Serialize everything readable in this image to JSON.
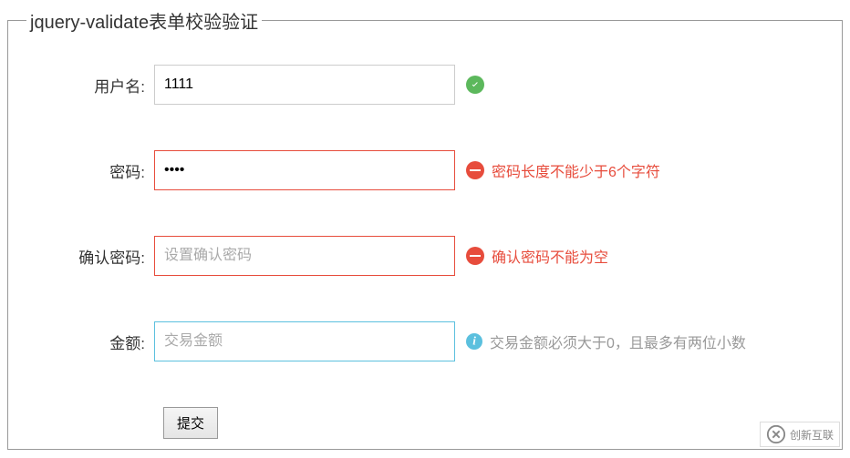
{
  "legend": "jquery-validate表单校验验证",
  "fields": {
    "username": {
      "label": "用户名:",
      "value": "1111",
      "status": "valid"
    },
    "password": {
      "label": "密码:",
      "value": "••••",
      "status": "error",
      "message": "密码长度不能少于6个字符"
    },
    "confirm": {
      "label": "确认密码:",
      "value": "",
      "placeholder": "设置确认密码",
      "status": "error",
      "message": "确认密码不能为空"
    },
    "amount": {
      "label": "金额:",
      "value": "",
      "placeholder": "交易金额",
      "status": "info",
      "message": "交易金额必须大于0，且最多有两位小数"
    }
  },
  "submit_label": "提交",
  "watermark": "创新互联"
}
